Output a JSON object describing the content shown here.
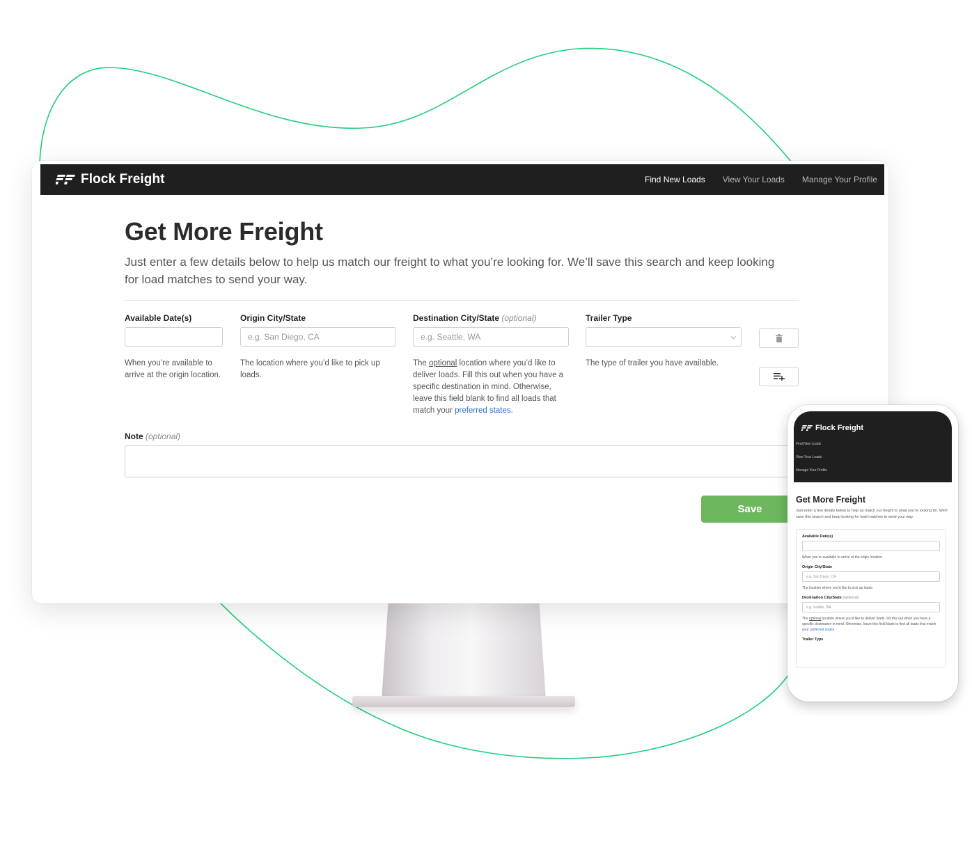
{
  "brand": {
    "name": "Flock Freight"
  },
  "nav": {
    "links": [
      {
        "label": "Find New Loads",
        "active": true
      },
      {
        "label": "View Your Loads",
        "active": false
      },
      {
        "label": "Manage Your Profile",
        "active": false
      }
    ]
  },
  "page": {
    "title": "Get More Freight",
    "intro": "Just enter a few details below to help us match our freight to what you’re looking for. We’ll save this search and keep looking for load matches to send your way."
  },
  "form": {
    "available_dates": {
      "label": "Available Date(s)",
      "value": "",
      "help": "When you’re available to arrive at the origin location."
    },
    "origin": {
      "label": "Origin City/State",
      "placeholder": "e.g. San Diego, CA",
      "help": "The location where you’d like to pick up loads."
    },
    "destination": {
      "label": "Destination City/State",
      "optional": "(optional)",
      "placeholder": "e.g. Seattle, WA",
      "help_before": "The",
      "help_optional": "optional",
      "help_after": "location where you’d like to deliver loads. Fill this out when you have a specific destination in mind. Otherwise, leave this field blank to find all loads that match your",
      "help_link": "preferred states",
      "help_end": "."
    },
    "trailer_type": {
      "label": "Trailer Type",
      "value": "",
      "help": "The type of trailer you have available."
    },
    "note": {
      "label": "Note",
      "optional": "(optional)",
      "value": ""
    },
    "save_label": "Save"
  },
  "icons": {
    "delete": "trash-icon",
    "add_row": "playlist-add-icon",
    "select": "chevron-down-icon",
    "logo": "flock-freight-logo-icon"
  },
  "colors": {
    "accent_green": "#6db85f",
    "blob_stroke": "#1fcf7a",
    "navbar": "#1f1f1f",
    "link": "#2f6fc4"
  },
  "phone": {
    "brand": "Flock Freight",
    "links": [
      "Find New Loads",
      "View Your Loads",
      "Manage Your Profile"
    ],
    "title": "Get More Freight",
    "intro": "Just enter a few details below to help us match our freight to what you’re looking for. We’ll save this search and keep looking for load matches to send your way.",
    "available_label": "Available Date(s)",
    "available_help": "When you’re available to arrive at the origin location.",
    "origin_label": "Origin City/State",
    "origin_placeholder": "e.g. San Diego, CA",
    "origin_help": "The location where you’d like to pick up loads.",
    "destination_label": "Destination City/State",
    "destination_optional": "(optional)",
    "destination_placeholder": "e.g. Seattle, WA",
    "destination_help_before": "The",
    "destination_help_optional": "optional",
    "destination_help_after": "location where you’d like to deliver loads. Fill this out when you have a specific destination in mind. Otherwise, leave this field blank to find all loads that match your",
    "destination_help_link": "preferred states",
    "destination_help_end": ".",
    "trailer_label": "Trailer Type"
  }
}
